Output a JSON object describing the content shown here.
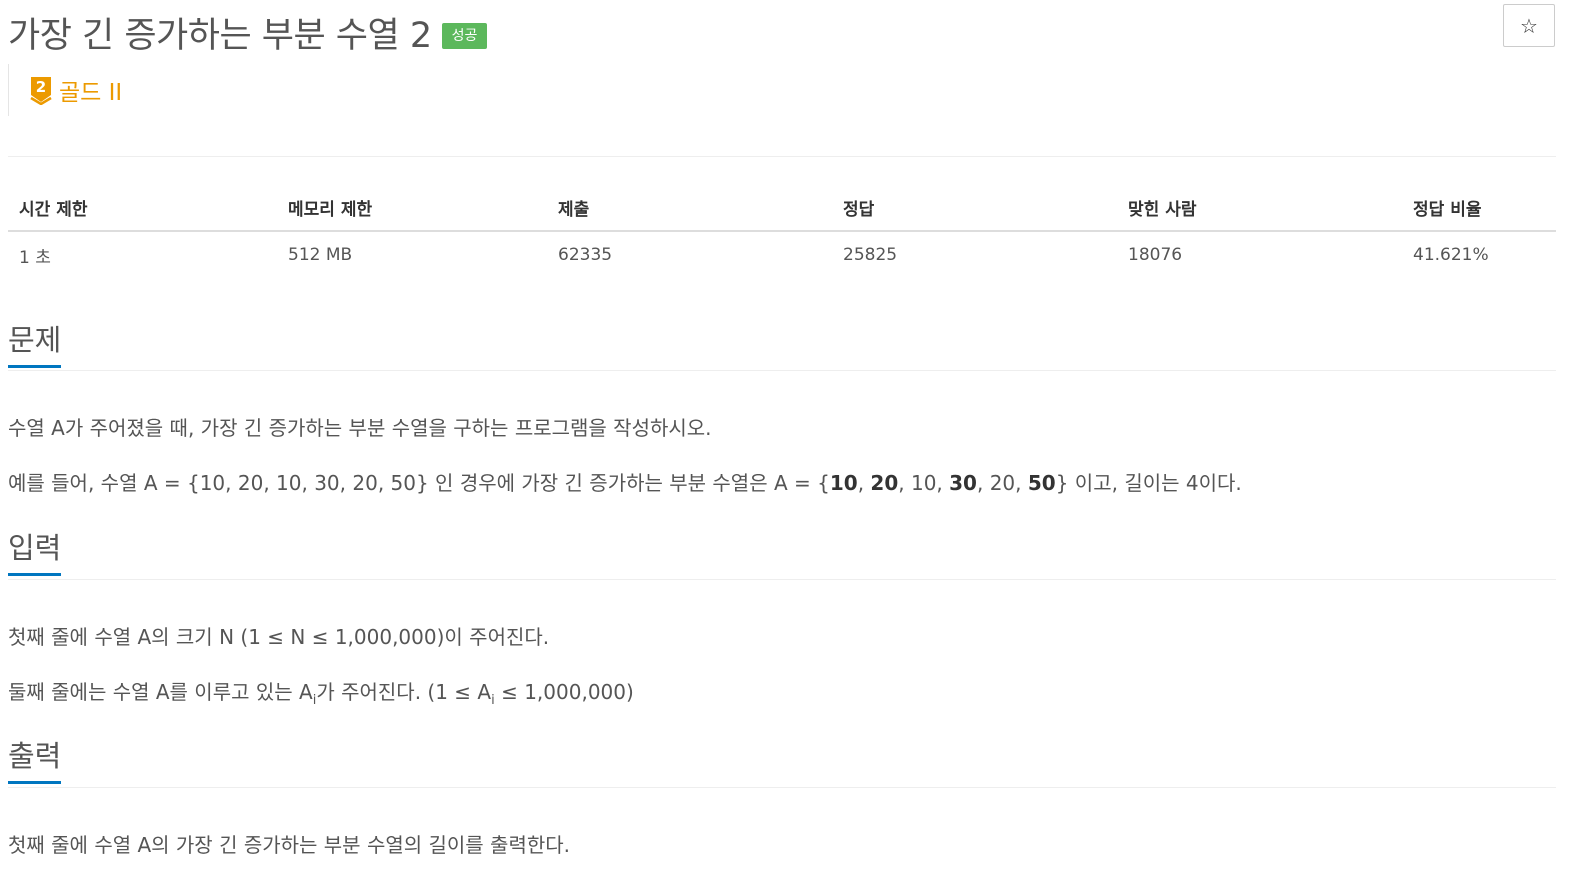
{
  "problem": {
    "title": "가장 긴 증가하는 부분 수열 2",
    "status_badge": "성공",
    "star_icon": "star-outline-icon",
    "tier": {
      "level_number": "2",
      "label": "골드 II",
      "color": "#ec9a00",
      "icon": "gold-tier-shield-icon"
    }
  },
  "info_table": {
    "headers": [
      "시간 제한",
      "메모리 제한",
      "제출",
      "정답",
      "맞힌 사람",
      "정답 비율"
    ],
    "values": [
      "1 초",
      "512 MB",
      "62335",
      "25825",
      "18076",
      "41.621%"
    ]
  },
  "sections": {
    "description": {
      "heading": "문제",
      "line1": "수열 A가 주어졌을 때, 가장 긴 증가하는 부분 수열을 구하는 프로그램을 작성하시오.",
      "line2_prefix": "예를 들어, 수열 A = {10, 20, 10, 30, 20, 50} 인 경우에 가장 긴 증가하는 부분 수열은 A = {",
      "line2_b1": "10",
      "line2_sep1": ", ",
      "line2_b2": "20",
      "line2_mid": ", 10, ",
      "line2_b3": "30",
      "line2_sep2": ", 20, ",
      "line2_b4": "50",
      "line2_suffix": "} 이고, 길이는 4이다."
    },
    "input": {
      "heading": "입력",
      "line1": "첫째 줄에 수열 A의 크기 N (1 ≤ N ≤ 1,000,000)이 주어진다.",
      "line2_a": "둘째 줄에는 수열 A를 이루고 있는 A",
      "line2_sub1": "i",
      "line2_b": "가 주어진다. (1 ≤ A",
      "line2_sub2": "i",
      "line2_c": " ≤ 1,000,000)"
    },
    "output": {
      "heading": "출력",
      "line1": "첫째 줄에 수열 A의 가장 긴 증가하는 부분 수열의 길이를 출력한다."
    },
    "accent_color": "#0076c0"
  },
  "colors": {
    "success_badge": "#5cb85c",
    "text": "#555555"
  }
}
